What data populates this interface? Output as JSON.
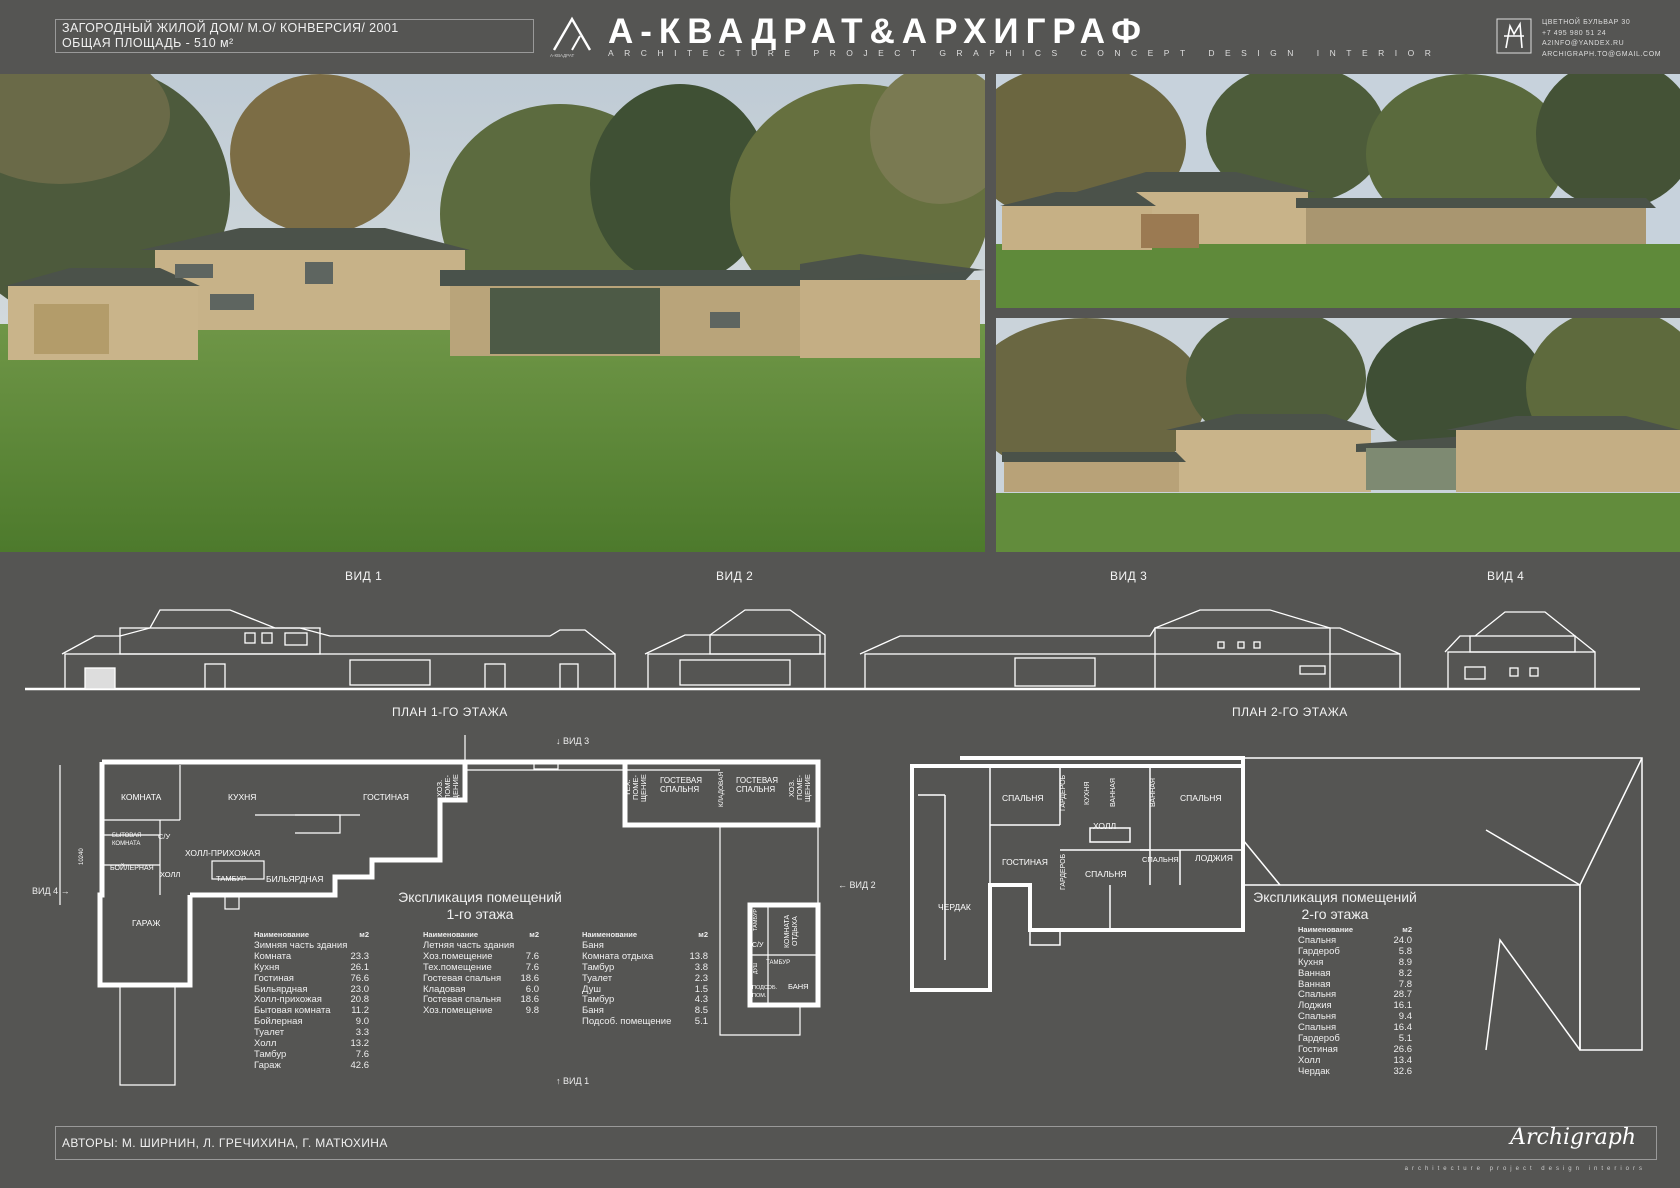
{
  "header": {
    "project_line1": "ЗАГОРОДНЫЙ ЖИЛОЙ ДОМ/ М.О/ КОНВЕРСИЯ/ 2001",
    "project_line2": "ОБЩАЯ ПЛОЩАДЬ - 510 м²",
    "brand_title": "А-КВАДРАТ&АРХИГРАФ",
    "brand_sub": "ARCHITECTURE PROJECT GRAPHICS CONCEPT DESIGN INTERIOR",
    "brand_logo_caption": "А-КВАДРАТ",
    "contact": [
      "ЦВЕТНОЙ БУЛЬВАР 30",
      "+7 495 980 51 24",
      "A2INFO@YANDEX.RU",
      "ARCHIGRAPH.TO@GMAIL.COM"
    ]
  },
  "views": {
    "v1": "ВИД 1",
    "v2": "ВИД 2",
    "v3": "ВИД 3",
    "v4": "ВИД 4"
  },
  "plans": {
    "floor1_title": "ПЛАН 1-ГО ЭТАЖА",
    "floor2_title": "ПЛАН 2-ГО ЭТАЖА",
    "dim": "10240",
    "f1_rooms": {
      "komnata": "КОМНАТА",
      "kuhnya": "КУХНЯ",
      "gostinaya": "ГОСТИНАЯ",
      "bytovaya": "БЫТОВАЯ КОМНАТА",
      "su": "С/У",
      "holl_prih": "ХОЛЛ-ПРИХОЖАЯ",
      "boylernaya": "БОЙЛЕРНАЯ",
      "holl": "ХОЛЛ",
      "tambur": "ТАМБУР",
      "bilyard": "БИЛЬЯРДНАЯ",
      "garazh": "ГАРАЖ",
      "hoz1": "ХОЗ. ПОМЕ- ЩЕНИЕ",
      "teh": "ТЕХ. ПОМЕ- ЩЕНИЕ",
      "gost_sp1": "ГОСТЕВАЯ СПАЛЬНЯ",
      "kladovaya": "КЛАДОВАЯ",
      "gost_sp2": "ГОСТЕВАЯ СПАЛЬНЯ",
      "hoz2": "ХОЗ. ПОМЕ- ЩЕНИЕ",
      "tambur2": "ТАМБУР",
      "su2": "С/У",
      "komnata_otdyha": "КОМНАТА ОТДЫХА",
      "dush": "ДУШ",
      "tambur3": "ТАМБУР",
      "podsob": "ПОДСОБ. ПОМ.",
      "banya": "БАНЯ"
    },
    "f2_rooms": {
      "spalnya1": "СПАЛЬНЯ",
      "garderob1": "ГАРДЕРОБ",
      "kuhnya": "КУХНЯ",
      "vannaya1": "ВАННАЯ",
      "vannaya2": "ВАННАЯ",
      "spalnya2": "СПАЛЬНЯ",
      "holl": "ХОЛЛ",
      "gostinaya": "ГОСТИНАЯ",
      "garderob2": "ГАРДЕРОБ",
      "spalnya3": "СПАЛЬНЯ",
      "spalnya4": "СПАЛЬНЯ",
      "lodzhiya": "ЛОДЖИЯ",
      "cherdak": "ЧЕРДАК"
    },
    "arrows": {
      "v1": "ВИД 1",
      "v2": "ВИД 2",
      "v3": "ВИД 3",
      "v4": "ВИД 4"
    }
  },
  "explication1": {
    "title1": "Экспликация помещений",
    "title2": "1-го этажа",
    "col1": {
      "h_name": "Наименование",
      "h_unit": "м2",
      "section": "Зимняя часть здания",
      "rows": [
        [
          "Комната",
          "23.3"
        ],
        [
          "Кухня",
          "26.1"
        ],
        [
          "Гостиная",
          "76.6"
        ],
        [
          "Бильярдная",
          "23.0"
        ],
        [
          "Холл-прихожая",
          "20.8"
        ],
        [
          "Бытовая комната",
          "11.2"
        ],
        [
          "Бойлерная",
          "9.0"
        ],
        [
          "Туалет",
          "3.3"
        ],
        [
          "Холл",
          "13.2"
        ],
        [
          "Тамбур",
          "7.6"
        ],
        [
          "Гараж",
          "42.6"
        ]
      ]
    },
    "col2": {
      "h_name": "Наименование",
      "h_unit": "м2",
      "section": "Летняя часть здания",
      "rows": [
        [
          "Хоз.помещение",
          "7.6"
        ],
        [
          "Тех.помещение",
          "7.6"
        ],
        [
          "Гостевая спальня",
          "18.6"
        ],
        [
          "Кладовая",
          "6.0"
        ],
        [
          "Гостевая спальня",
          "18.6"
        ],
        [
          "Хоз.помещение",
          "9.8"
        ]
      ]
    },
    "col3": {
      "h_name": "Наименование",
      "h_unit": "м2",
      "section": "Баня",
      "rows": [
        [
          "Комната отдыха",
          "13.8"
        ],
        [
          "Тамбур",
          "3.8"
        ],
        [
          "Туалет",
          "2.3"
        ],
        [
          "Душ",
          "1.5"
        ],
        [
          "Тамбур",
          "4.3"
        ],
        [
          "Баня",
          "8.5"
        ],
        [
          "Подсоб. помещение",
          "5.1"
        ]
      ]
    }
  },
  "explication2": {
    "title1": "Экспликация помещений",
    "title2": "2-го этажа",
    "h_name": "Наименование",
    "h_unit": "м2",
    "rows": [
      [
        "Спальня",
        "24.0"
      ],
      [
        "Гардероб",
        "5.8"
      ],
      [
        "Кухня",
        "8.9"
      ],
      [
        "Ванная",
        "8.2"
      ],
      [
        "Ванная",
        "7.8"
      ],
      [
        "Спальня",
        "28.7"
      ],
      [
        "Лоджия",
        "16.1"
      ],
      [
        "Спальня",
        "9.4"
      ],
      [
        "Спальня",
        "16.4"
      ],
      [
        "Гардероб",
        "5.1"
      ],
      [
        "Гостиная",
        "26.6"
      ],
      [
        "Холл",
        "13.4"
      ],
      [
        "Чердак",
        "32.6"
      ]
    ]
  },
  "footer": {
    "authors": "АВТОРЫ: М. ШИРНИН, Л. ГРЕЧИХИНА, Г. МАТЮХИНА",
    "signature": "Archigraph",
    "signature_sub": "architecture project design interiors"
  },
  "colors": {
    "background": "#555553",
    "lines": "#ffffff",
    "sky": "#c9d3dd",
    "grass": "#5f8a3a",
    "walls": "#c8b389",
    "roof": "#50574e"
  }
}
